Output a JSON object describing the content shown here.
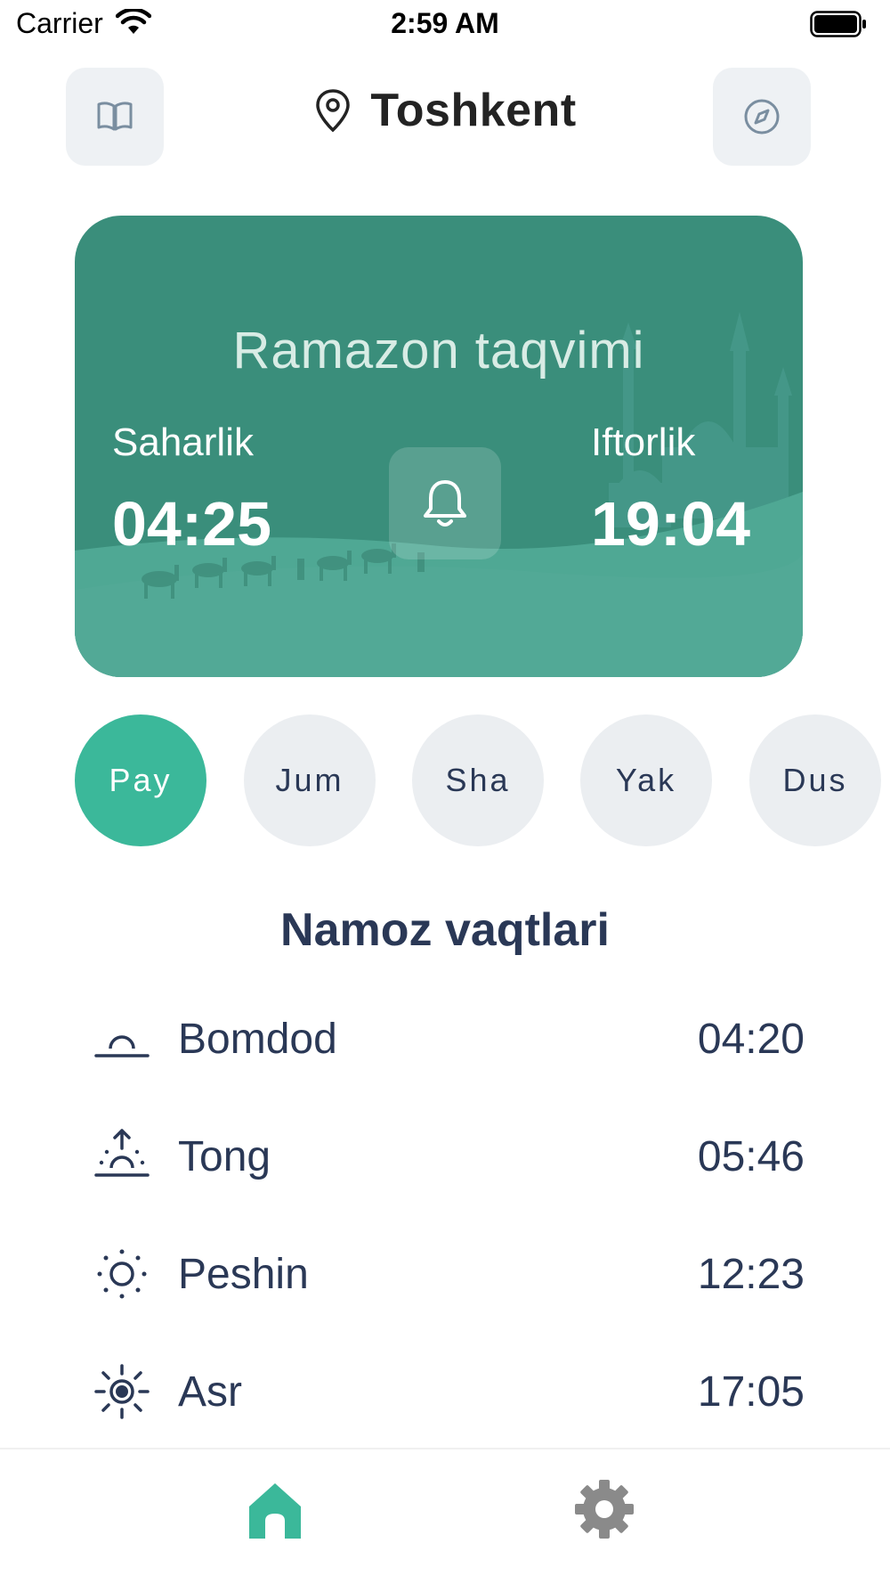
{
  "status_bar": {
    "carrier": "Carrier",
    "time": "2:59 AM"
  },
  "header": {
    "city": "Toshkent",
    "left_icon": "book-open-icon",
    "right_icon": "compass-icon",
    "pin_icon": "map-pin-icon"
  },
  "ramadan_card": {
    "title": "Ramazon taqvimi",
    "saharlik_label": "Saharlik",
    "saharlik_time": "04:25",
    "iftorlik_label": "Iftorlik",
    "iftorlik_time": "19:04",
    "bell_icon": "bell-icon"
  },
  "days": [
    {
      "label": "Pay",
      "active": true
    },
    {
      "label": "Jum",
      "active": false
    },
    {
      "label": "Sha",
      "active": false
    },
    {
      "label": "Yak",
      "active": false
    },
    {
      "label": "Dus",
      "active": false
    }
  ],
  "prayer_section": {
    "title": "Namoz vaqtlari",
    "items": [
      {
        "name": "Bomdod",
        "time": "04:20",
        "icon": "dawn-icon"
      },
      {
        "name": "Tong",
        "time": "05:46",
        "icon": "sunrise-icon"
      },
      {
        "name": "Peshin",
        "time": "12:23",
        "icon": "sun-icon"
      },
      {
        "name": "Asr",
        "time": "17:05",
        "icon": "sun-bright-icon"
      }
    ]
  },
  "tab_bar": {
    "items": [
      {
        "icon": "home-icon",
        "active": true
      },
      {
        "icon": "gear-icon",
        "active": false
      }
    ]
  },
  "colors": {
    "accent": "#3bb89a",
    "card": "#3a8e7b",
    "text": "#2a3856",
    "pill_bg": "#ebeef1"
  }
}
